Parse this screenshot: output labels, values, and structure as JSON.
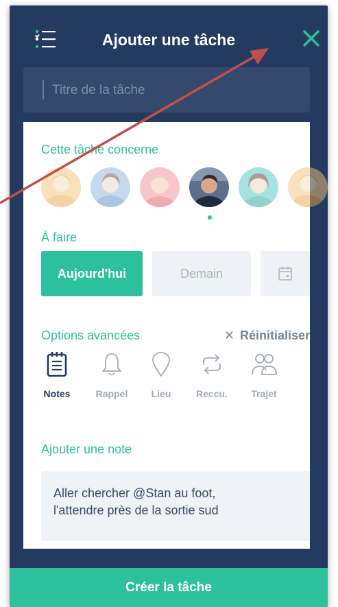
{
  "header": {
    "title": "Ajouter une tâche",
    "menu_icon": "list-menu-icon",
    "close_icon": "close-icon"
  },
  "title_field": {
    "placeholder": "Titre de la tâche",
    "value": ""
  },
  "assignee": {
    "label": "Cette tâche concerne",
    "avatars": [
      {
        "name": "avatar-1",
        "bg": "#f3c47a",
        "selected": false
      },
      {
        "name": "avatar-2",
        "bg": "#8fb4dc",
        "selected": false
      },
      {
        "name": "avatar-3",
        "bg": "#ef8e96",
        "selected": false
      },
      {
        "name": "avatar-4",
        "bg": "#5d6d8c",
        "selected": true
      },
      {
        "name": "avatar-5",
        "bg": "#4fc6c0",
        "selected": false
      },
      {
        "name": "avatar-6",
        "bg": "#f3c47a",
        "selected": false
      }
    ]
  },
  "todo": {
    "label": "À faire",
    "today": "Aujourd'hui",
    "tomorrow": "Demain",
    "calendar_icon": "calendar-icon"
  },
  "advanced": {
    "label": "Options avancées",
    "reset_label": "Réinitialiser",
    "options": [
      {
        "label": "Notes",
        "icon": "notepad-icon",
        "active": true
      },
      {
        "label": "Rappel",
        "icon": "bell-icon",
        "active": false
      },
      {
        "label": "Lieu",
        "icon": "location-pin-icon",
        "active": false
      },
      {
        "label": "Reccu.",
        "icon": "repeat-icon",
        "active": false
      },
      {
        "label": "Trajet",
        "icon": "people-icon",
        "active": false
      }
    ]
  },
  "note": {
    "label": "Ajouter une note",
    "line1": "Aller chercher @Stan au foot,",
    "line2": "l'attendre près de la sortie sud"
  },
  "footer": {
    "create_label": "Créer la tâche"
  },
  "colors": {
    "accent": "#2cc19c",
    "navy": "#243a5e",
    "annotation_arrow": "#c0504d"
  }
}
